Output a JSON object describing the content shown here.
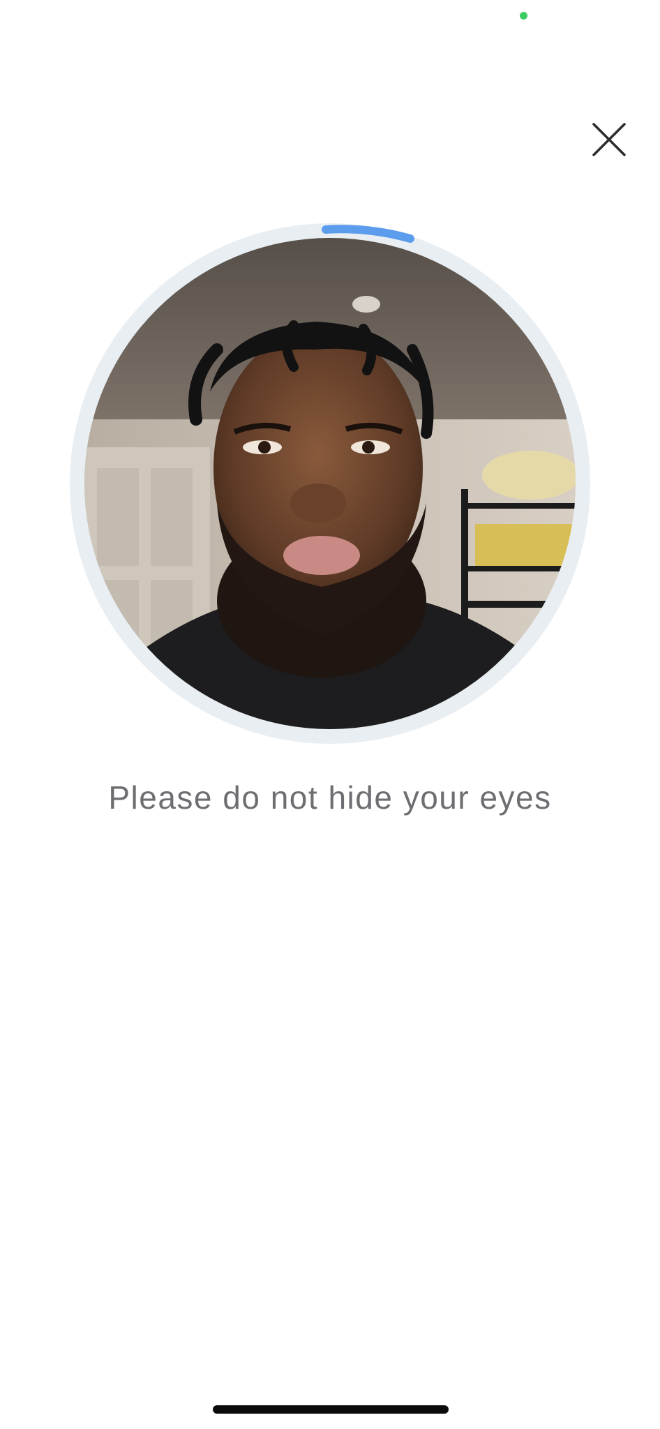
{
  "status_bar": {
    "indicator_icon": "privacy-indicator-dot",
    "indicator_color": "#3dcc62"
  },
  "header": {
    "close_icon": "close-icon"
  },
  "camera": {
    "ring_color": "#e9eef2",
    "progress_color": "#5c9cec",
    "preview_subject": "live selfie camera preview"
  },
  "instruction": {
    "text": "Please do not hide your eyes"
  },
  "home_indicator": {
    "color": "#0b0b0b"
  }
}
